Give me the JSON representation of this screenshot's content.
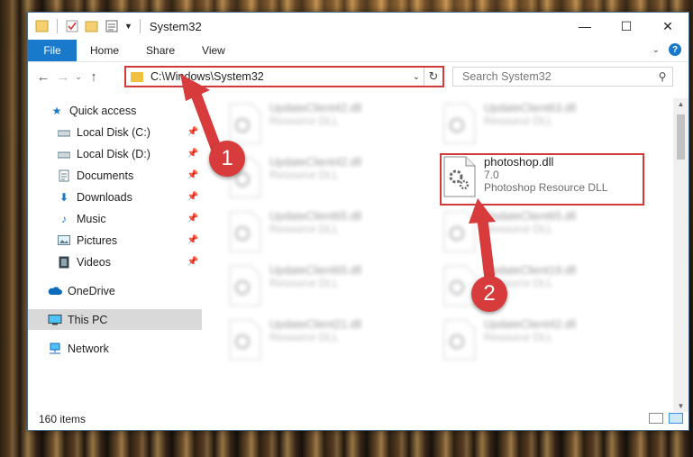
{
  "window": {
    "title": "System32",
    "controls": {
      "minimize": "—",
      "maximize": "☐",
      "close": "✕"
    }
  },
  "ribbon": {
    "tabs": [
      "File",
      "Home",
      "Share",
      "View"
    ]
  },
  "address": {
    "path": "C:\\Windows\\System32"
  },
  "search": {
    "placeholder": "Search System32"
  },
  "sidebar": {
    "items": [
      {
        "label": "Quick access",
        "icon": "star-icon"
      },
      {
        "label": "Local Disk (C:)",
        "icon": "drive-icon"
      },
      {
        "label": "Local Disk (D:)",
        "icon": "drive-icon"
      },
      {
        "label": "Documents",
        "icon": "document-icon"
      },
      {
        "label": "Downloads",
        "icon": "download-icon"
      },
      {
        "label": "Music",
        "icon": "music-icon"
      },
      {
        "label": "Pictures",
        "icon": "pictures-icon"
      },
      {
        "label": "Videos",
        "icon": "videos-icon"
      },
      {
        "label": "OneDrive",
        "icon": "cloud-icon"
      },
      {
        "label": "This PC",
        "icon": "computer-icon"
      },
      {
        "label": "Network",
        "icon": "network-icon"
      }
    ]
  },
  "files": [
    {
      "name": "UpdateClient42.dll",
      "desc": "Resource DLL"
    },
    {
      "name": "UpdateClient63.dll",
      "desc": "Resource DLL"
    },
    {
      "name": "UpdateClient42.dll",
      "desc": "Resource DLL"
    },
    {
      "name": "photoshop.dll",
      "version": "7.0",
      "desc": "Photoshop Resource DLL"
    },
    {
      "name": "UpdateClient65.dll",
      "desc": "Resource DLL"
    },
    {
      "name": "UpdateClient65.dll",
      "desc": "Resource DLL"
    },
    {
      "name": "UpdateClient65.dll",
      "desc": "Resource DLL"
    },
    {
      "name": "UpdateClient19.dll",
      "desc": "Resource DLL"
    },
    {
      "name": "UpdateClient21.dll",
      "desc": "Resource DLL"
    },
    {
      "name": "UpdateClient42.dll",
      "desc": "Resource DLL"
    }
  ],
  "status": {
    "count": "160 items"
  },
  "annotations": {
    "step1": "1",
    "step2": "2"
  },
  "colors": {
    "accent": "#1979ca",
    "highlight": "#d23a3a"
  }
}
